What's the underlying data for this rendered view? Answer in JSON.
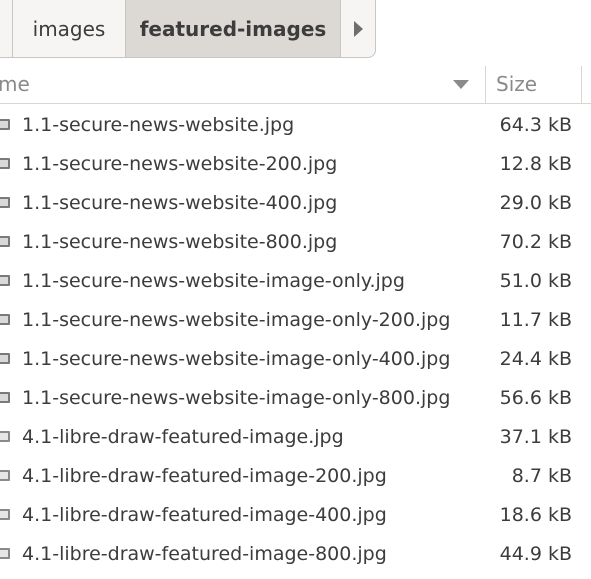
{
  "pathbar": {
    "crumbs": [
      "images",
      "featured-images"
    ],
    "active": "featured-images",
    "next_icon": "arrow-right-icon"
  },
  "columns": {
    "name": "me",
    "size": "Size",
    "sort_icon": "sort-descending-icon"
  },
  "files": [
    {
      "name": "1.1-secure-news-website.jpg",
      "size": "64.3 kB",
      "icon": "image-file-icon"
    },
    {
      "name": "1.1-secure-news-website-200.jpg",
      "size": "12.8 kB",
      "icon": "image-file-icon"
    },
    {
      "name": "1.1-secure-news-website-400.jpg",
      "size": "29.0 kB",
      "icon": "image-file-icon"
    },
    {
      "name": "1.1-secure-news-website-800.jpg",
      "size": "70.2 kB",
      "icon": "image-file-icon"
    },
    {
      "name": "1.1-secure-news-website-image-only.jpg",
      "size": "51.0 kB",
      "icon": "image-file-icon"
    },
    {
      "name": "1.1-secure-news-website-image-only-200.jpg",
      "size": "11.7 kB",
      "icon": "image-file-icon"
    },
    {
      "name": "1.1-secure-news-website-image-only-400.jpg",
      "size": "24.4 kB",
      "icon": "image-file-icon"
    },
    {
      "name": "1.1-secure-news-website-image-only-800.jpg",
      "size": "56.6 kB",
      "icon": "image-file-icon"
    },
    {
      "name": "4.1-libre-draw-featured-image.jpg",
      "size": "37.1 kB",
      "icon": "image-file-icon"
    },
    {
      "name": "4.1-libre-draw-featured-image-200.jpg",
      "size": "8.7 kB",
      "icon": "image-file-icon"
    },
    {
      "name": "4.1-libre-draw-featured-image-400.jpg",
      "size": "18.6 kB",
      "icon": "image-file-icon"
    },
    {
      "name": "4.1-libre-draw-featured-image-800.jpg",
      "size": "44.9 kB",
      "icon": "image-file-icon"
    }
  ]
}
